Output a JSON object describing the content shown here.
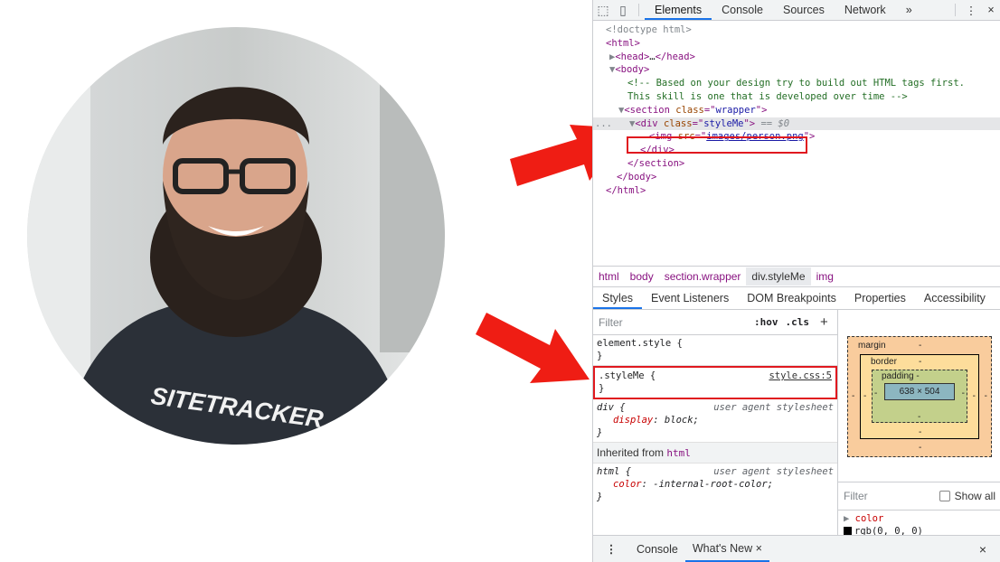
{
  "photo": {
    "shirt_text": "SITETRACKER"
  },
  "devtools": {
    "tabs": [
      "Elements",
      "Console",
      "Sources",
      "Network"
    ],
    "more_tabs": "»",
    "dom_lines": {
      "doctype": "<!doctype html>",
      "html_open": "html",
      "head": "head",
      "head_ellipsis": "…",
      "body_open": "body",
      "comment_1": "<!-- Based on your design try to build out HTML tags first.",
      "comment_2": "This skill is one that is developed over time -->",
      "section_tag": "section",
      "section_attr": "class",
      "section_val": "wrapper",
      "div_tag": "div",
      "div_attr": "class",
      "div_val": "styleMe",
      "div_eq": "== $0",
      "img_tag": "img",
      "img_attr": "src",
      "img_val": "images/person.png",
      "div_close": "div",
      "section_close": "section",
      "body_close": "body",
      "html_close": "html",
      "gutter_dots": "..."
    },
    "breadcrumbs": [
      "html",
      "body",
      "section.wrapper",
      "div.styleMe",
      "img"
    ],
    "subtabs": [
      "Styles",
      "Event Listeners",
      "DOM Breakpoints",
      "Properties",
      "Accessibility"
    ],
    "styles_filter_placeholder": "Filter",
    "hov_label": ":hov",
    "cls_label": ".cls",
    "plus_label": "+",
    "rules": {
      "element_style": "element.style {",
      "element_close": "}",
      "styleme_selector": ".styleMe {",
      "styleme_source": "style.css:5",
      "styleme_close": "}",
      "div_selector": "div {",
      "div_source": "user agent stylesheet",
      "div_prop": "display",
      "div_value": "block;",
      "div_close": "}",
      "inherited_label": "Inherited from",
      "inherited_tag": "html",
      "html_selector": "html {",
      "html_source": "user agent stylesheet",
      "html_prop": "color",
      "html_value": "-internal-root-color;",
      "html_close": "}"
    },
    "box_model": {
      "margin_label": "margin",
      "margin_val": "-",
      "border_label": "border",
      "border_val": "-",
      "padding_label": "padding -",
      "content": "638 × 504",
      "dash": "-"
    },
    "computed_filter_placeholder": "Filter",
    "show_all_label": "Show all",
    "computed_prop": "color",
    "computed_value": "rgb(0, 0, 0)",
    "drawer_tabs": [
      "Console",
      "What's New"
    ],
    "drawer_tab_close": "×",
    "close_icon": "×"
  },
  "colors": {
    "annotation": "#e0181f",
    "accent": "#1a73e8"
  }
}
